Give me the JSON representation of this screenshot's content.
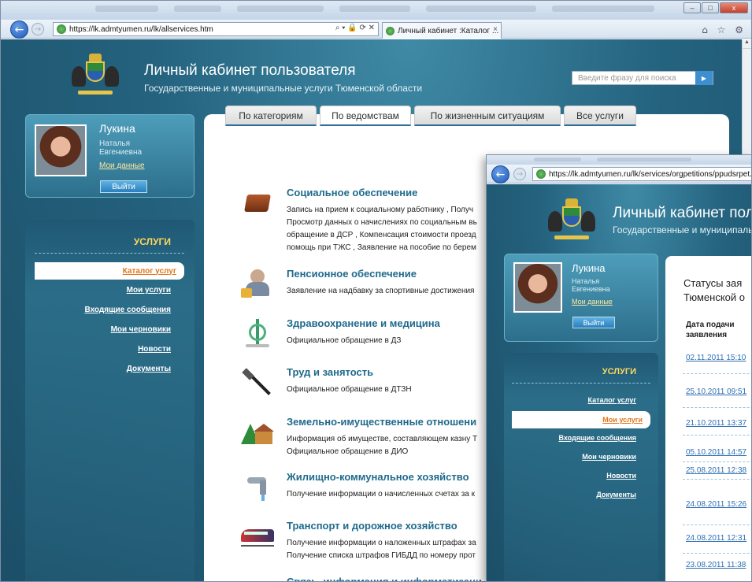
{
  "browser": {
    "url": "https://lk.admtyumen.ru/lk/allservices.htm",
    "tab_title": "Личный кабинет :Каталог ...",
    "tab_close": "×",
    "back": "←",
    "forward": "→",
    "address_tools": "⌕ ▾ 🔒 ⟳ ✕",
    "window_buttons": [
      "–",
      "□",
      "x"
    ],
    "right_icons": "⌂ ☆ ⚙"
  },
  "header": {
    "title": "Личный кабинет пользователя",
    "subtitle": "Государственные и муниципальные услуги Тюменской области",
    "search_placeholder": "Введите фразу для поиска",
    "search_go": "▶"
  },
  "user": {
    "surname": "Лукина",
    "name": "Наталья",
    "patronymic": "Евгениевна",
    "my_data": "Мои данные",
    "logout": "Выйти"
  },
  "menu": {
    "title": "УСЛУГИ",
    "items": [
      "Каталог услуг",
      "Мои услуги",
      "Входящие сообщения",
      "Мои черновики",
      "Новости",
      "Документы"
    ]
  },
  "tabs": [
    "По категориям",
    "По ведомствам",
    "По жизненным ситуациям",
    "Все услуги"
  ],
  "categories": [
    {
      "title": "Социальное обеспечение",
      "lines": [
        "Запись на прием к социальному работнику , Получ",
        "Просмотр данных о начислениях по социальным вь",
        "обращение в ДСР , Компенсация стоимости проезд",
        "помощь при ТЖС , Заявление на пособие по берем"
      ]
    },
    {
      "title": "Пенсионное обеспечение",
      "lines": [
        "Заявление на надбавку за спортивные достижения"
      ]
    },
    {
      "title": "Здравоохранение и медицина",
      "lines": [
        "Официальное обращение в ДЗ"
      ]
    },
    {
      "title": "Труд и занятость",
      "lines": [
        "Официальное обращение в ДТЗН"
      ]
    },
    {
      "title": "Земельно-имущественные отношени",
      "lines": [
        "Информация об имуществе, составляющем казну Т",
        "Официальное обращение в ДИО"
      ]
    },
    {
      "title": "Жилищно-коммунальное хозяйство",
      "lines": [
        "Получение информации о начисленных счетах за к"
      ]
    },
    {
      "title": "Транспорт и дорожное хозяйство",
      "lines": [
        "Получение информации о наложенных штрафах за",
        "Получение списка штрафов ГИБДД по номеру прот"
      ]
    },
    {
      "title": "Связь, информация и информатизаци",
      "lines": []
    }
  ],
  "window2": {
    "url": "https://lk.admtyumen.ru/lk/services/orgpetitions/ppudsrpet.htm?data",
    "title": "Личный кабинет пол",
    "subtitle": "Государственные и муниципальн",
    "status_title_1": "Статусы зая",
    "status_title_2": "Тюменской о",
    "date_head_1": "Дата подачи",
    "date_head_2": "заявления",
    "active_menu": "Мои услуги",
    "dates": [
      "02.11.2011 15:10",
      "25.10.2011 09:51",
      "21.10.2011 13:37",
      "05.10.2011 14:57",
      "25.08.2011 12:38",
      "24.08.2011 15:26",
      "24.08.2011 12:31",
      "23.08.2011 11:38"
    ]
  }
}
